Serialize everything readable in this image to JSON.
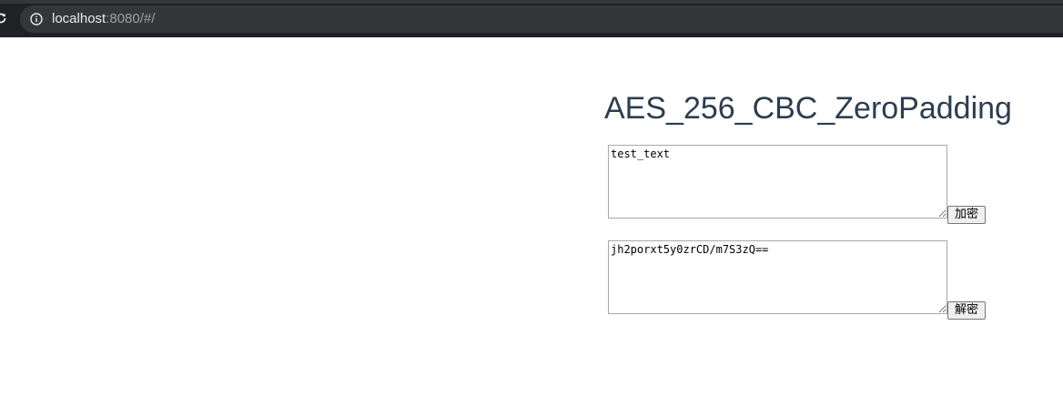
{
  "browser": {
    "url_host": "localhost",
    "url_rest": ":8080/#/"
  },
  "page": {
    "title": "AES_256_CBC_ZeroPadding",
    "plaintext_value": "test_text",
    "encrypt_button_label": "加密",
    "ciphertext_value": "jh2porxt5y0zrCD/m7S3zQ==",
    "decrypt_button_label": "解密"
  },
  "colors": {
    "chrome_bg": "#202124",
    "omnibox_bg": "#35363a",
    "title_color": "#2c3e50"
  }
}
